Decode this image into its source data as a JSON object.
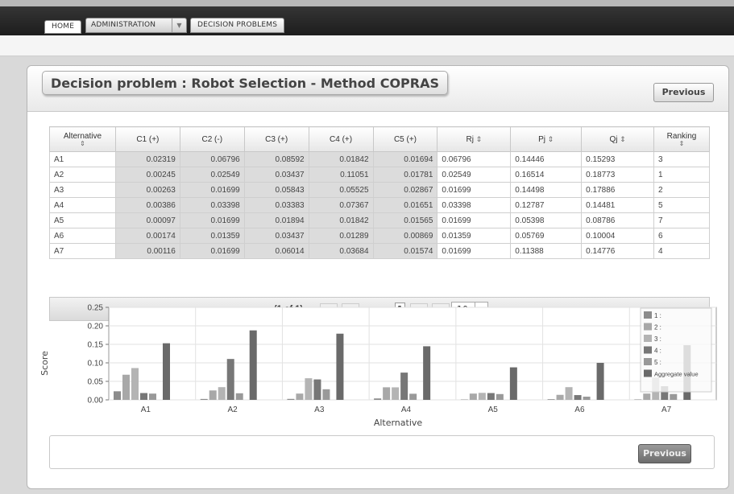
{
  "nav": {
    "home": "HOME",
    "administration": "ADMINISTRATION",
    "decision_problems": "DECISION PROBLEMS"
  },
  "page": {
    "title": "Decision problem : Robot Selection - Method COPRAS",
    "previous_label": "Previous"
  },
  "table": {
    "columns": [
      "Alternative",
      "C1 (+)",
      "C2 (-)",
      "C3 (+)",
      "C4 (+)",
      "C5 (+)",
      "Rj",
      "Pj",
      "Qj",
      "Ranking"
    ],
    "rows": [
      [
        "A1",
        "0.02319",
        "0.06796",
        "0.08592",
        "0.01842",
        "0.01694",
        "0.06796",
        "0.14446",
        "0.15293",
        "3"
      ],
      [
        "A2",
        "0.00245",
        "0.02549",
        "0.03437",
        "0.11051",
        "0.01781",
        "0.02549",
        "0.16514",
        "0.18773",
        "1"
      ],
      [
        "A3",
        "0.00263",
        "0.01699",
        "0.05843",
        "0.05525",
        "0.02867",
        "0.01699",
        "0.14498",
        "0.17886",
        "2"
      ],
      [
        "A4",
        "0.00386",
        "0.03398",
        "0.03383",
        "0.07367",
        "0.01651",
        "0.03398",
        "0.12787",
        "0.14481",
        "5"
      ],
      [
        "A5",
        "0.00097",
        "0.01699",
        "0.01894",
        "0.01842",
        "0.01565",
        "0.01699",
        "0.05398",
        "0.08786",
        "7"
      ],
      [
        "A6",
        "0.00174",
        "0.01359",
        "0.03437",
        "0.01289",
        "0.00869",
        "0.01359",
        "0.05769",
        "0.10004",
        "6"
      ],
      [
        "A7",
        "0.00116",
        "0.01699",
        "0.06014",
        "0.03684",
        "0.01574",
        "0.01699",
        "0.11388",
        "0.14776",
        "4"
      ]
    ]
  },
  "pager": {
    "info": "(1 of 1)",
    "current_page": "1",
    "rows_per_page": "10"
  },
  "chart_data": {
    "type": "bar",
    "categories": [
      "A1",
      "A2",
      "A3",
      "A4",
      "A5",
      "A6",
      "A7"
    ],
    "xlabel": "Alternative",
    "ylabel": "Score",
    "ylim": [
      0,
      0.25
    ],
    "yticks": [
      "0.00",
      "0.05",
      "0.10",
      "0.15",
      "0.20",
      "0.25"
    ],
    "legend_position": "right",
    "grid": true,
    "series": [
      {
        "name": "1 :",
        "color": "#8c8c8c",
        "values": [
          0.02319,
          0.00245,
          0.00263,
          0.00386,
          0.00097,
          0.00174,
          0.00116
        ]
      },
      {
        "name": "2 :",
        "color": "#a8a8a8",
        "values": [
          0.06796,
          0.02549,
          0.01699,
          0.03398,
          0.01699,
          0.01359,
          0.01699
        ]
      },
      {
        "name": "3 :",
        "color": "#b4b4b4",
        "values": [
          0.08592,
          0.03437,
          0.05843,
          0.03383,
          0.01894,
          0.03437,
          0.06014
        ]
      },
      {
        "name": "4 :",
        "color": "#777777",
        "values": [
          0.01842,
          0.11051,
          0.05525,
          0.07367,
          0.01842,
          0.01289,
          0.03684
        ]
      },
      {
        "name": "5 :",
        "color": "#999999",
        "values": [
          0.01694,
          0.01781,
          0.02867,
          0.01651,
          0.01565,
          0.00869,
          0.01574
        ]
      },
      {
        "name": "Aggregate value",
        "color": "#6a6a6a",
        "values": [
          0.15293,
          0.18773,
          0.17886,
          0.14481,
          0.08786,
          0.10004,
          0.14776
        ]
      }
    ]
  }
}
